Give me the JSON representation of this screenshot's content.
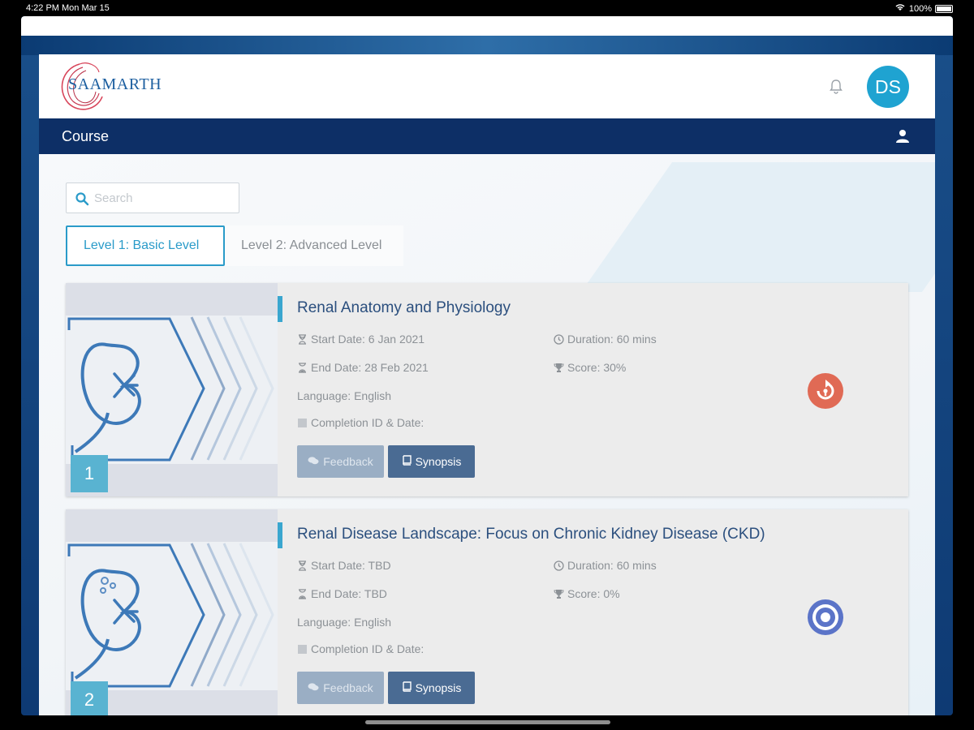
{
  "status_bar": {
    "time": "4:22 PM  Mon Mar 15",
    "battery": "100%"
  },
  "header": {
    "logo_text": "SAAMARTH",
    "avatar_initials": "DS"
  },
  "nav": {
    "title": "Course"
  },
  "search": {
    "placeholder": "Search",
    "value": ""
  },
  "tabs": [
    {
      "label": "Level 1: Basic Level",
      "active": true
    },
    {
      "label": "Level 2: Advanced Level",
      "active": false
    }
  ],
  "courses": [
    {
      "number": "1",
      "title": "Renal Anatomy and Physiology",
      "start_date": "Start Date: 6 Jan 2021",
      "end_date": "End Date: 28 Feb 2021",
      "duration": "Duration: 60 mins",
      "score": "Score: 30%",
      "language": "Language: English",
      "completion": "Completion ID & Date:",
      "feedback_label": "Feedback",
      "synopsis_label": "Synopsis",
      "status_icon": "resume-icon",
      "status_color": "#e06a55"
    },
    {
      "number": "2",
      "title": "Renal Disease Landscape: Focus on Chronic Kidney Disease (CKD)",
      "start_date": "Start Date: TBD",
      "end_date": "End Date: TBD",
      "duration": "Duration: 60 mins",
      "score": "Score: 0%",
      "language": "Language: English",
      "completion": "Completion ID & Date:",
      "feedback_label": "Feedback",
      "synopsis_label": "Synopsis",
      "status_icon": "target-icon",
      "status_color": "#5b74c8"
    }
  ],
  "colors": {
    "accent": "#2a9bc9",
    "navbar": "#0d2f66",
    "title": "#2b4f7e"
  }
}
